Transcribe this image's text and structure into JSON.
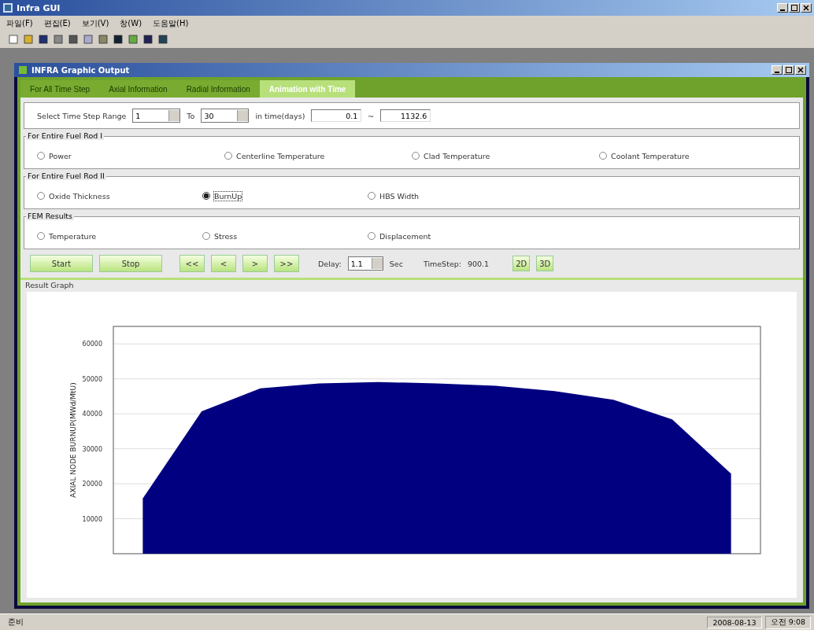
{
  "window": {
    "title": "Infra GUI"
  },
  "menu": [
    "파일(F)",
    "편집(E)",
    "보기(V)",
    "창(W)",
    "도움말(H)"
  ],
  "child_window": {
    "title": "INFRA Graphic Output"
  },
  "tabs": [
    {
      "label": "For All Time Step",
      "selected": false
    },
    {
      "label": "Axial Information",
      "selected": false
    },
    {
      "label": "Radial Information",
      "selected": false
    },
    {
      "label": "Animation with Time",
      "selected": true
    }
  ],
  "range": {
    "label": "Select Time Step Range",
    "from": "1",
    "to_label": "To",
    "to": "30",
    "time_label": "in time(days)",
    "time_from": "0.1",
    "tilde": "~",
    "time_to": "1132.6"
  },
  "groups": [
    {
      "title": "For Entire Fuel Rod I",
      "options": [
        {
          "label": "Power",
          "selected": false
        },
        {
          "label": "Centerline Temperature",
          "selected": false
        },
        {
          "label": "Clad Temperature",
          "selected": false
        },
        {
          "label": "Coolant Temperature",
          "selected": false
        }
      ]
    },
    {
      "title": "For Entire Fuel Rod II",
      "options": [
        {
          "label": "Oxide Thickness",
          "selected": false
        },
        {
          "label": "BurnUp",
          "selected": true
        },
        {
          "label": "HBS Width",
          "selected": false
        }
      ]
    },
    {
      "title": "FEM Results",
      "options": [
        {
          "label": "Temperature",
          "selected": false
        },
        {
          "label": "Stress",
          "selected": false
        },
        {
          "label": "Displacement",
          "selected": false
        }
      ]
    }
  ],
  "controls": {
    "start": "Start",
    "stop": "Stop",
    "nav": [
      "<<",
      "<",
      ">",
      ">>"
    ],
    "delay_label": "Delay:",
    "delay": "1.1",
    "sec": "Sec",
    "timestep_label": "TimeStep:",
    "timestep": "900.1",
    "views": [
      "2D",
      "3D"
    ]
  },
  "graph": {
    "title": "Result Graph",
    "chart_data": {
      "type": "area",
      "ylabel": "AXIAL NODE BURNUP(MWd/MtU)",
      "categories": [
        null,
        null,
        null,
        null,
        null,
        null,
        null,
        null,
        null,
        null,
        null
      ],
      "series": [
        {
          "color": "#000080",
          "values": [
            15800,
            40700,
            47300,
            48700,
            49100,
            48700,
            48000,
            46500,
            44000,
            38400,
            22900
          ]
        }
      ],
      "ylim": [
        0,
        65000
      ],
      "yticks": [
        10000,
        20000,
        30000,
        40000,
        50000,
        60000
      ],
      "grid": true
    }
  },
  "status_bar": {
    "text": "준비",
    "date": "2008-08-13",
    "time": "오전 9:08"
  }
}
